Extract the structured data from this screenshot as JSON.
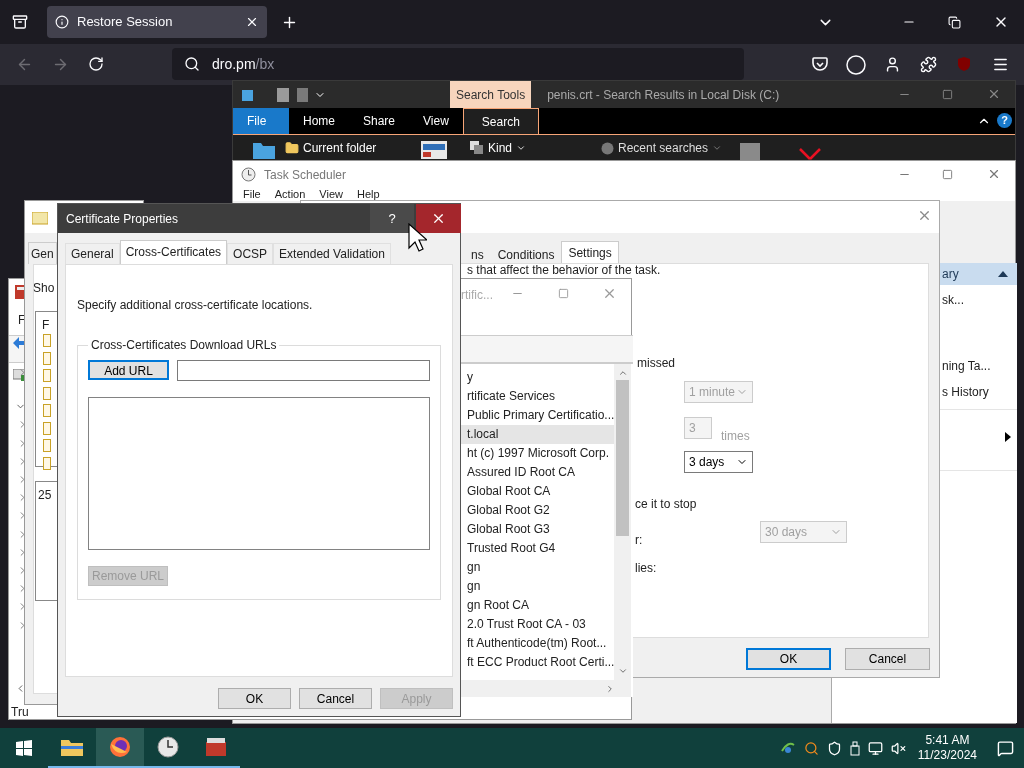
{
  "browser": {
    "tab": {
      "title": "Restore Session"
    },
    "url": {
      "host": "dro.pm",
      "path": "/bx"
    }
  },
  "explorer": {
    "title": "penis.crt - Search Results in Local Disk (C:)",
    "context_tab": "Search Tools",
    "ribbon_tabs": [
      {
        "label": "File",
        "kind": "file",
        "selected": false
      },
      {
        "label": "Home",
        "kind": "tab",
        "selected": false
      },
      {
        "label": "Share",
        "kind": "tab",
        "selected": false
      },
      {
        "label": "View",
        "kind": "tab",
        "selected": false
      },
      {
        "label": "Search",
        "kind": "tab",
        "selected": true
      }
    ],
    "ribbon_items": [
      "Current folder",
      "Kind",
      "Recent searches"
    ],
    "help": "?"
  },
  "task_scheduler": {
    "title": "Task Scheduler",
    "menu": [
      "File",
      "Action",
      "View",
      "Help"
    ],
    "actions": [
      {
        "label": "ary",
        "kind": "header"
      },
      {
        "label": "sk...",
        "kind": "item"
      },
      {
        "label": "ning Ta...",
        "kind": "item"
      },
      {
        "label": "s History",
        "kind": "item"
      },
      {
        "kind": "submenu"
      }
    ]
  },
  "task_properties": {
    "tabs": [
      {
        "label": "ns",
        "selected": false
      },
      {
        "label": "Conditions",
        "selected": false
      },
      {
        "label": "Settings",
        "selected": true
      }
    ],
    "description": "s that affect the behavior of the task.",
    "texts": [
      "missed",
      "ce it to stop",
      "r:",
      "lies:"
    ],
    "restart_interval": {
      "value": "1 minute",
      "disabled": true
    },
    "restart_count": {
      "value": "3",
      "unit": "times",
      "disabled": true
    },
    "stop_after": {
      "value": "3 days",
      "disabled": false
    },
    "delete_after": {
      "value": "30 days",
      "disabled": true
    },
    "buttons": [
      {
        "label": "OK",
        "default": true
      },
      {
        "label": "Cancel",
        "default": false
      }
    ]
  },
  "certificates_console": {
    "title": "rtific...",
    "menu_letter": "F",
    "status": "Tru",
    "items": [
      {
        "label": "y",
        "selected": false
      },
      {
        "label": "rtificate Services",
        "selected": false
      },
      {
        "label": "Public Primary Certificatio...",
        "selected": false
      },
      {
        "label": "t.local",
        "selected": true
      },
      {
        "label": "ht (c) 1997 Microsoft Corp.",
        "selected": false
      },
      {
        "label": "Assured ID Root CA",
        "selected": false
      },
      {
        "label": "Global Root CA",
        "selected": false
      },
      {
        "label": "Global Root G2",
        "selected": false
      },
      {
        "label": "Global Root G3",
        "selected": false
      },
      {
        "label": "Trusted Root G4",
        "selected": false
      },
      {
        "label": "gn",
        "selected": false
      },
      {
        "label": "gn",
        "selected": false
      },
      {
        "label": "gn Root CA",
        "selected": false
      },
      {
        "label": "2.0 Trust Root CA - 03",
        "selected": false
      },
      {
        "label": "ft Authenticode(tm) Root...",
        "selected": false
      },
      {
        "label": "ft ECC Product Root Certi...",
        "selected": false
      }
    ]
  },
  "certificate_dialog": {
    "tab": "Gen",
    "text": "Sho",
    "list_header": "F",
    "field": "25"
  },
  "certificate_properties": {
    "title": "Certificate Properties",
    "help": "?",
    "tabs": [
      {
        "label": "General",
        "selected": false
      },
      {
        "label": "Cross-Certificates",
        "selected": true
      },
      {
        "label": "OCSP",
        "selected": false
      },
      {
        "label": "Extended Validation",
        "selected": false
      }
    ],
    "description": "Specify additional cross-certificate locations.",
    "group_label": "Cross-Certificates Download URLs",
    "add_button": {
      "label": "Add URL",
      "disabled": false
    },
    "remove_button": {
      "label": "Remove URL",
      "disabled": true
    },
    "buttons": [
      {
        "label": "OK",
        "disabled": false
      },
      {
        "label": "Cancel",
        "disabled": false
      },
      {
        "label": "Apply",
        "disabled": true
      }
    ]
  },
  "taskbar": {
    "apps": [
      {
        "kind": "explorer",
        "selected": false
      },
      {
        "kind": "firefox",
        "selected": true
      },
      {
        "kind": "clock",
        "selected": false
      },
      {
        "kind": "toolbox",
        "selected": false
      }
    ],
    "time": "5:41 AM",
    "date": "11/23/2024"
  }
}
